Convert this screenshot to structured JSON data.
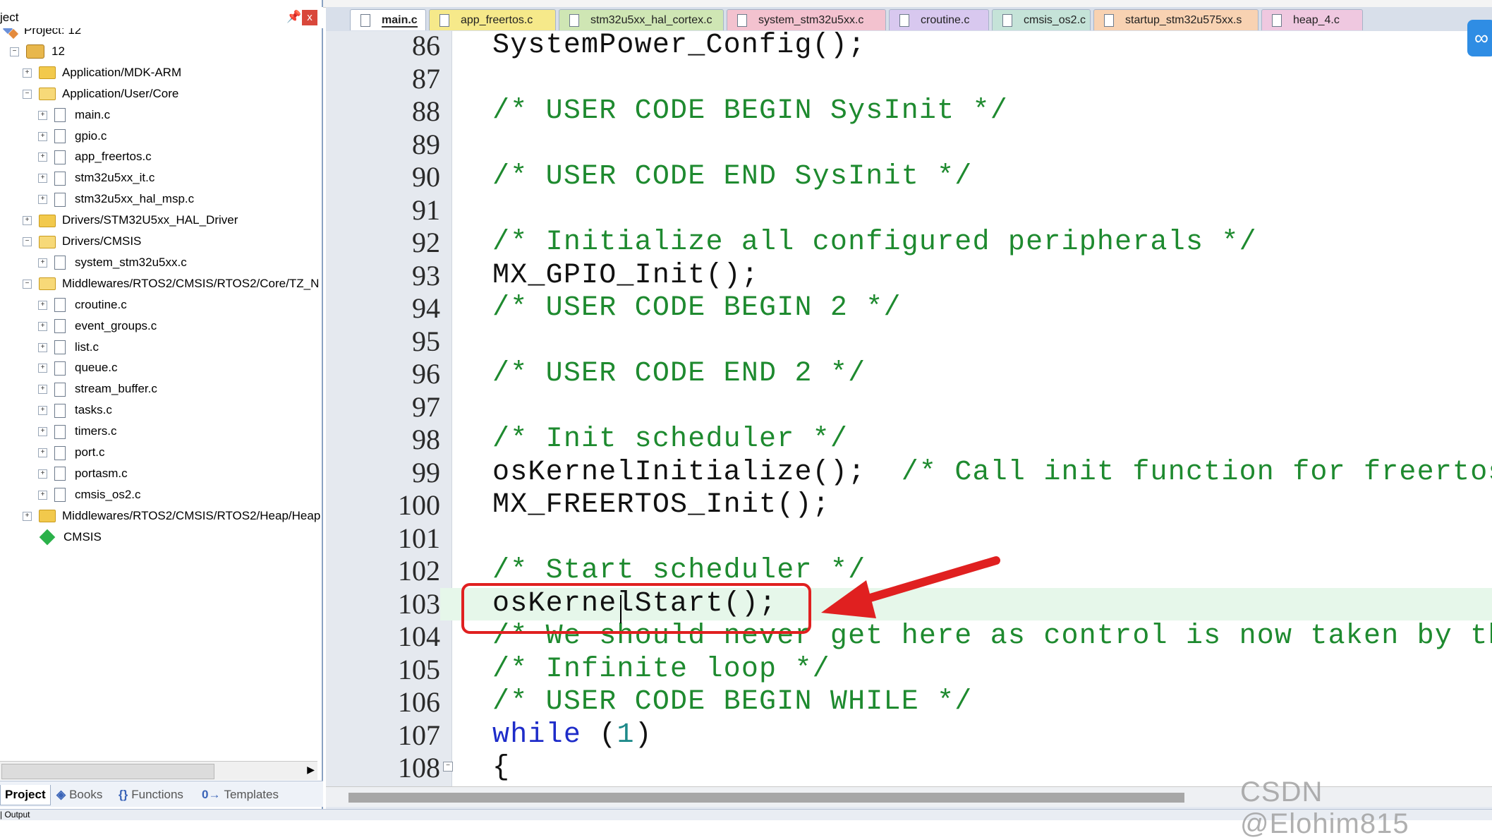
{
  "window": {
    "top_strip": ""
  },
  "project_panel": {
    "title": "ject",
    "pin_glyph": "⬛",
    "close_glyph": "x",
    "tree": [
      {
        "indent": 0,
        "kind": "project",
        "label": "Project: 12",
        "expander": ""
      },
      {
        "indent": 1,
        "kind": "target",
        "label": "12",
        "expander": "−"
      },
      {
        "indent": 2,
        "kind": "folder",
        "label": "Application/MDK-ARM",
        "expander": "+"
      },
      {
        "indent": 2,
        "kind": "folder-open",
        "label": "Application/User/Core",
        "expander": "−"
      },
      {
        "indent": 3,
        "kind": "file",
        "label": "main.c",
        "expander": "+"
      },
      {
        "indent": 3,
        "kind": "file",
        "label": "gpio.c",
        "expander": "+"
      },
      {
        "indent": 3,
        "kind": "file",
        "label": "app_freertos.c",
        "expander": "+"
      },
      {
        "indent": 3,
        "kind": "file",
        "label": "stm32u5xx_it.c",
        "expander": "+"
      },
      {
        "indent": 3,
        "kind": "file",
        "label": "stm32u5xx_hal_msp.c",
        "expander": "+"
      },
      {
        "indent": 2,
        "kind": "folder",
        "label": "Drivers/STM32U5xx_HAL_Driver",
        "expander": "+"
      },
      {
        "indent": 2,
        "kind": "folder-open",
        "label": "Drivers/CMSIS",
        "expander": "−"
      },
      {
        "indent": 3,
        "kind": "file",
        "label": "system_stm32u5xx.c",
        "expander": "+"
      },
      {
        "indent": 2,
        "kind": "folder-open",
        "label": "Middlewares/RTOS2/CMSIS/RTOS2/Core/TZ_N",
        "expander": "−"
      },
      {
        "indent": 3,
        "kind": "file",
        "label": "croutine.c",
        "expander": "+"
      },
      {
        "indent": 3,
        "kind": "file",
        "label": "event_groups.c",
        "expander": "+"
      },
      {
        "indent": 3,
        "kind": "file",
        "label": "list.c",
        "expander": "+"
      },
      {
        "indent": 3,
        "kind": "file",
        "label": "queue.c",
        "expander": "+"
      },
      {
        "indent": 3,
        "kind": "file",
        "label": "stream_buffer.c",
        "expander": "+"
      },
      {
        "indent": 3,
        "kind": "file",
        "label": "tasks.c",
        "expander": "+"
      },
      {
        "indent": 3,
        "kind": "file",
        "label": "timers.c",
        "expander": "+"
      },
      {
        "indent": 3,
        "kind": "file",
        "label": "port.c",
        "expander": "+"
      },
      {
        "indent": 3,
        "kind": "file",
        "label": "portasm.c",
        "expander": "+"
      },
      {
        "indent": 3,
        "kind": "file",
        "label": "cmsis_os2.c",
        "expander": "+"
      },
      {
        "indent": 2,
        "kind": "folder",
        "label": "Middlewares/RTOS2/CMSIS/RTOS2/Heap/Heap",
        "expander": "+"
      },
      {
        "indent": 2,
        "kind": "cmsis",
        "label": "CMSIS",
        "expander": ""
      }
    ],
    "bottom_tabs": [
      {
        "label": "Project",
        "icon": "",
        "active": true
      },
      {
        "label": "Books",
        "icon": "◈",
        "active": false
      },
      {
        "label": "Functions",
        "icon": "{}",
        "active": false
      },
      {
        "label": "Templates",
        "icon": "0→",
        "active": false
      }
    ]
  },
  "output_strip": {
    "label": "| Output"
  },
  "file_tabs": [
    {
      "label": "main.c",
      "color": "#ffffff",
      "active": true
    },
    {
      "label": "app_freertos.c",
      "color": "#f6e98a",
      "active": false
    },
    {
      "label": "stm32u5xx_hal_cortex.c",
      "color": "#cfe6b4",
      "active": false
    },
    {
      "label": "system_stm32u5xx.c",
      "color": "#f3c2cf",
      "active": false
    },
    {
      "label": "croutine.c",
      "color": "#d8c8ef",
      "active": false
    },
    {
      "label": "cmsis_os2.c",
      "color": "#c5e3d8",
      "active": false
    },
    {
      "label": "startup_stm32u575xx.s",
      "color": "#f8d2b2",
      "active": false
    },
    {
      "label": "heap_4.c",
      "color": "#efc8e0",
      "active": false
    }
  ],
  "code_lines": [
    {
      "n": "86",
      "text": "SystemPower_Config();",
      "type": "code"
    },
    {
      "n": "87",
      "text": "",
      "type": "code"
    },
    {
      "n": "88",
      "text": "/* USER CODE BEGIN SysInit */",
      "type": "comment"
    },
    {
      "n": "89",
      "text": "",
      "type": "code"
    },
    {
      "n": "90",
      "text": "/* USER CODE END SysInit */",
      "type": "comment"
    },
    {
      "n": "91",
      "text": "",
      "type": "code"
    },
    {
      "n": "92",
      "text": "/* Initialize all configured peripherals */",
      "type": "comment"
    },
    {
      "n": "93",
      "text": "MX_GPIO_Init();",
      "type": "code"
    },
    {
      "n": "94",
      "text": "/* USER CODE BEGIN 2 */",
      "type": "comment"
    },
    {
      "n": "95",
      "text": "",
      "type": "code"
    },
    {
      "n": "96",
      "text": "/* USER CODE END 2 */",
      "type": "comment"
    },
    {
      "n": "97",
      "text": "",
      "type": "code"
    },
    {
      "n": "98",
      "text": "/* Init scheduler */",
      "type": "comment"
    },
    {
      "n": "99",
      "text": "osKernelInitialize();",
      "type": "code",
      "trailing_comment": "  /* Call init function for freertos obj"
    },
    {
      "n": "100",
      "text": "MX_FREERTOS_Init();",
      "type": "code"
    },
    {
      "n": "101",
      "text": "",
      "type": "code"
    },
    {
      "n": "102",
      "text": "/* Start scheduler */",
      "type": "comment"
    },
    {
      "n": "103",
      "text": "osKernelStart();",
      "type": "code",
      "highlight": true
    },
    {
      "n": "104",
      "text": "/* We should never get here as control is now taken by the sc",
      "type": "comment"
    },
    {
      "n": "105",
      "text": "/* Infinite loop */",
      "type": "comment"
    },
    {
      "n": "106",
      "text": "/* USER CODE BEGIN WHILE */",
      "type": "comment"
    },
    {
      "n": "107",
      "text": "while (1)",
      "type": "while"
    },
    {
      "n": "108",
      "text": "{",
      "type": "code",
      "fold": true
    }
  ],
  "float_button_glyph": "∞",
  "watermark": "CSDN @Elohim815",
  "colors": {
    "comment": "#1e8a2f",
    "keyword": "#1e2cc9",
    "annotation": "#e02020",
    "highlight_line": "#e6f7ea"
  }
}
